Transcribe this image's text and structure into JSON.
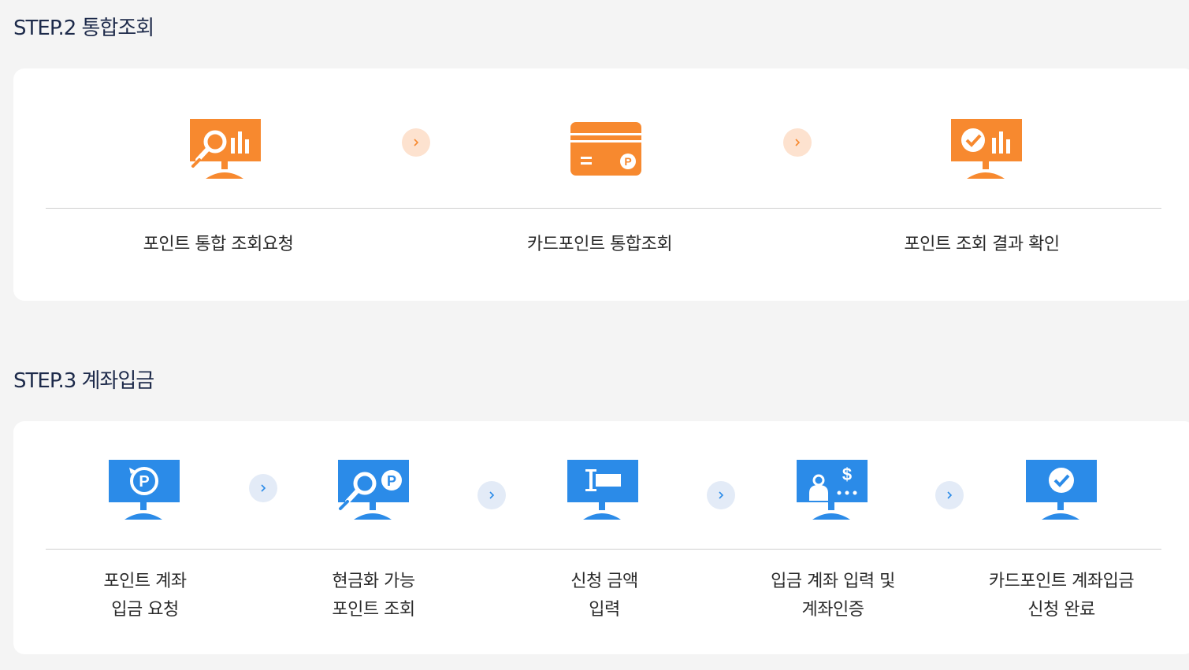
{
  "step2": {
    "title": "STEP.2 통합조회",
    "items": [
      {
        "label": "포인트 통합 조회요청",
        "icon": "monitor-search-chart-icon"
      },
      {
        "label": "카드포인트 통합조회",
        "icon": "point-card-icon"
      },
      {
        "label": "포인트 조회 결과 확인",
        "icon": "monitor-check-chart-icon"
      }
    ],
    "accent": "#f7892f"
  },
  "step3": {
    "title": "STEP.3 계좌입금",
    "items": [
      {
        "line1": "포인트 계좌",
        "line2": "입금 요청",
        "icon": "monitor-point-refresh-icon"
      },
      {
        "line1": "현금화 가능",
        "line2": "포인트 조회",
        "icon": "monitor-search-point-icon"
      },
      {
        "line1": "신청 금액",
        "line2": "입력",
        "icon": "monitor-input-cursor-icon"
      },
      {
        "line1": "입금 계좌 입력 및",
        "line2": "계좌인증",
        "icon": "monitor-user-dollar-icon"
      },
      {
        "line1": "카드포인트 계좌입금",
        "line2": "신청 완료",
        "icon": "monitor-check-icon"
      }
    ],
    "accent": "#2b8be8"
  }
}
